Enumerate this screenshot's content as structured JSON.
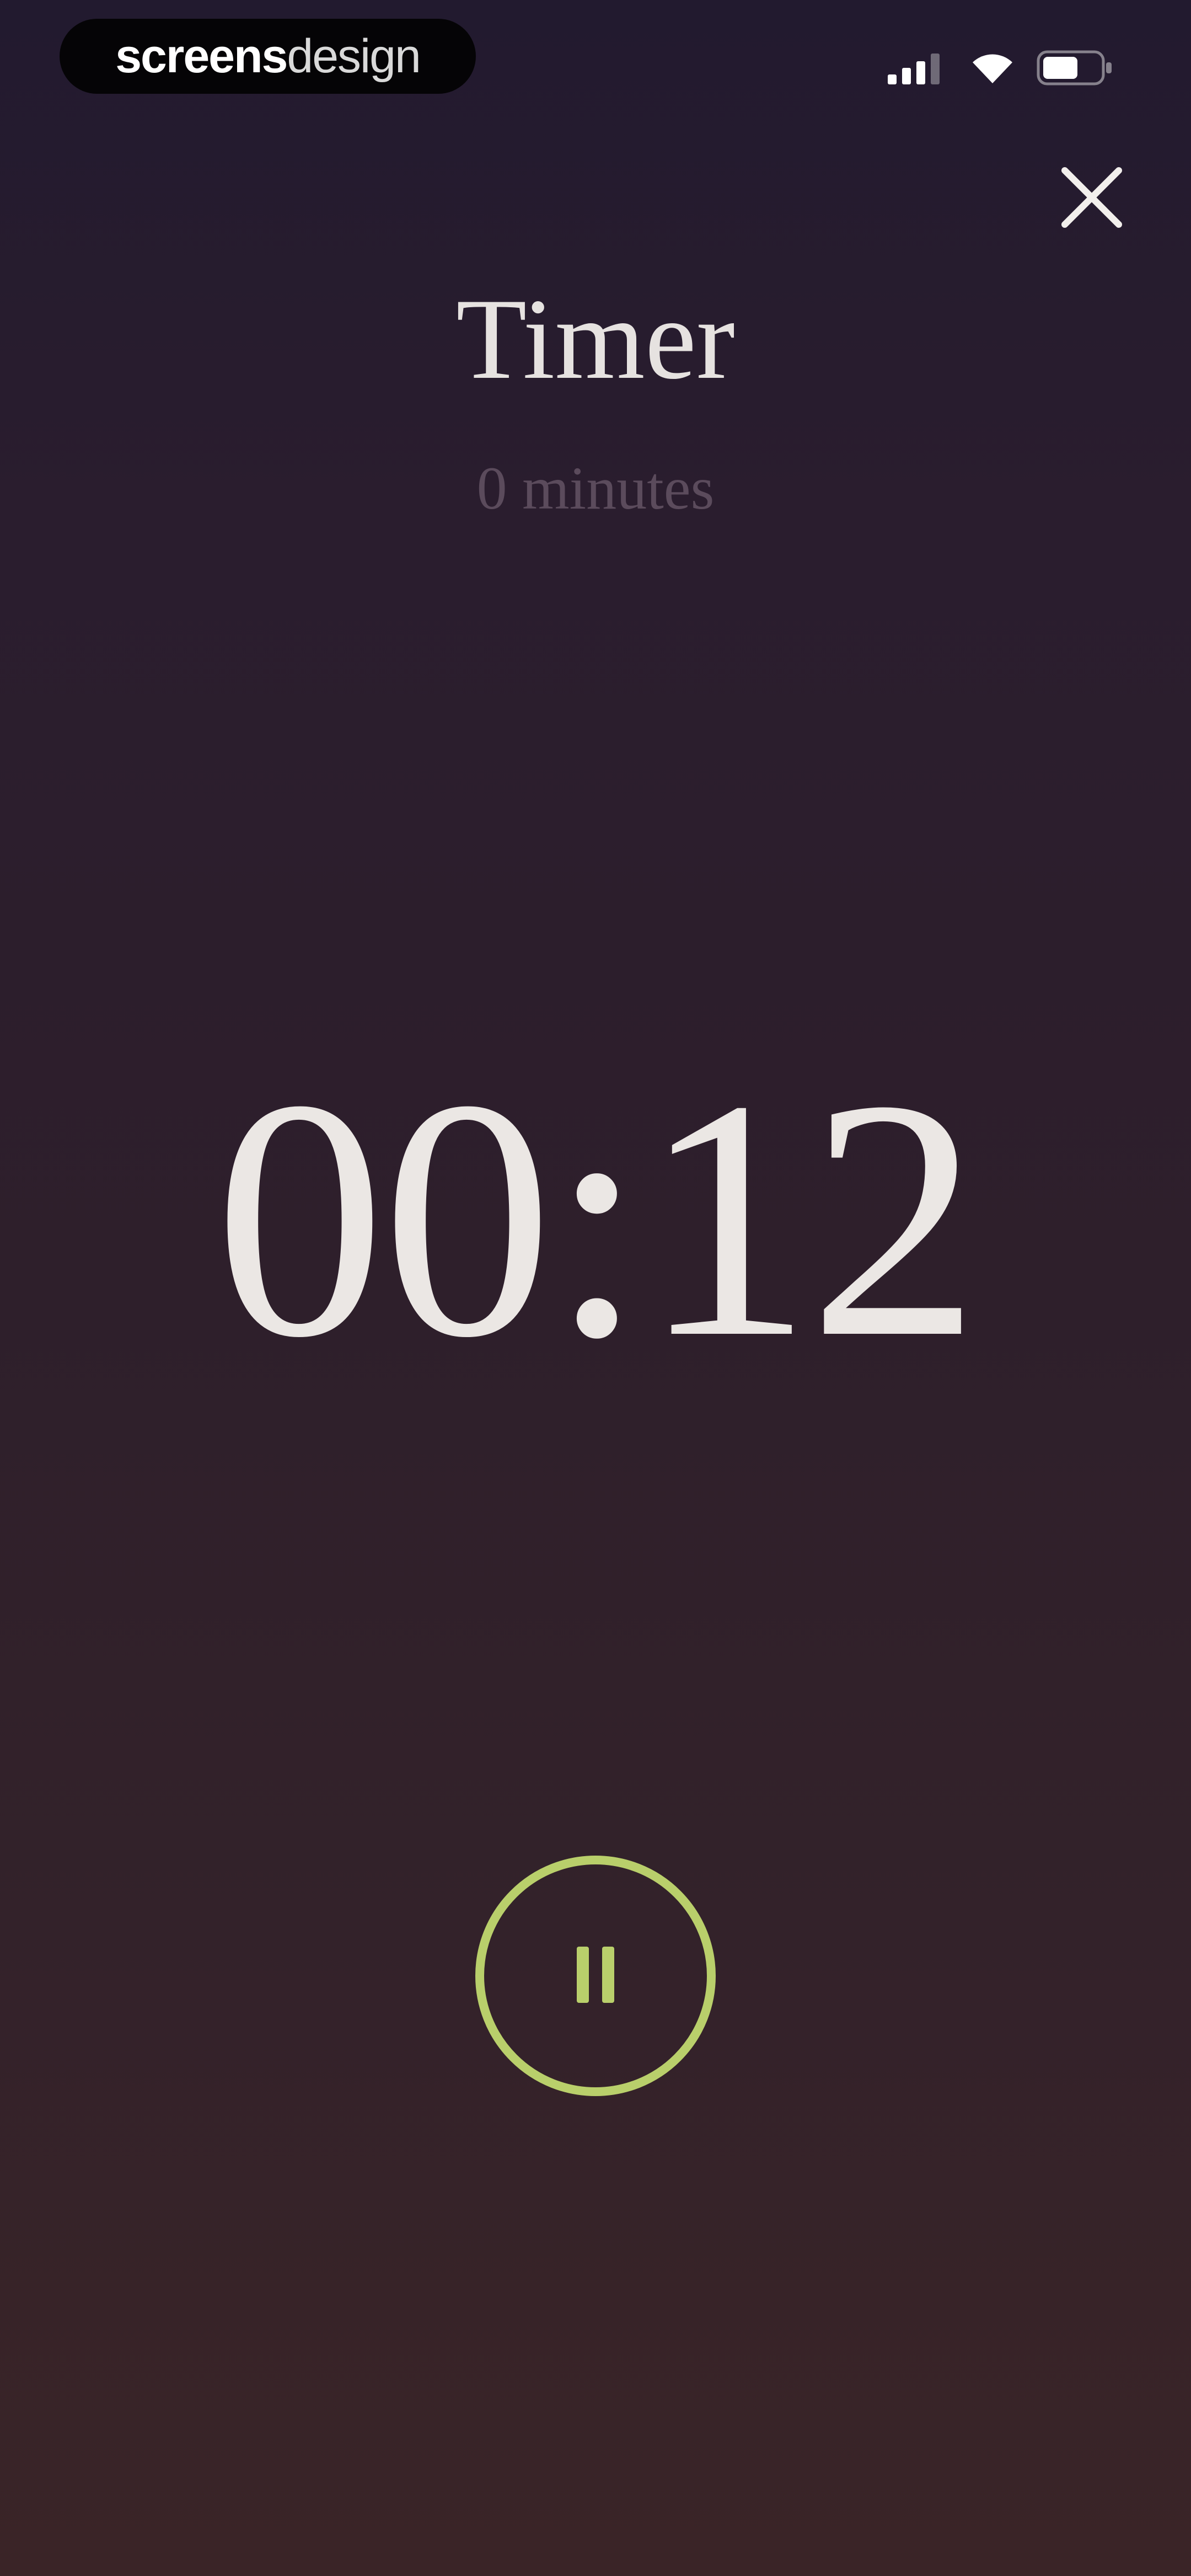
{
  "status_bar": {
    "brand_part1": "screens",
    "brand_part2": "design",
    "icons": [
      "signal-icon",
      "wifi-icon",
      "battery-icon"
    ]
  },
  "header": {
    "title": "Timer",
    "subtitle": "0 minutes",
    "close_icon": "close-icon"
  },
  "timer": {
    "display": "00:12"
  },
  "controls": {
    "pause_icon": "pause-icon"
  },
  "colors": {
    "accent": "#b9cf6b",
    "text": "#ebe7e4",
    "subtitle": "#5b4b5c",
    "background_top": "#221a2f",
    "background_bottom": "#3a2427"
  }
}
